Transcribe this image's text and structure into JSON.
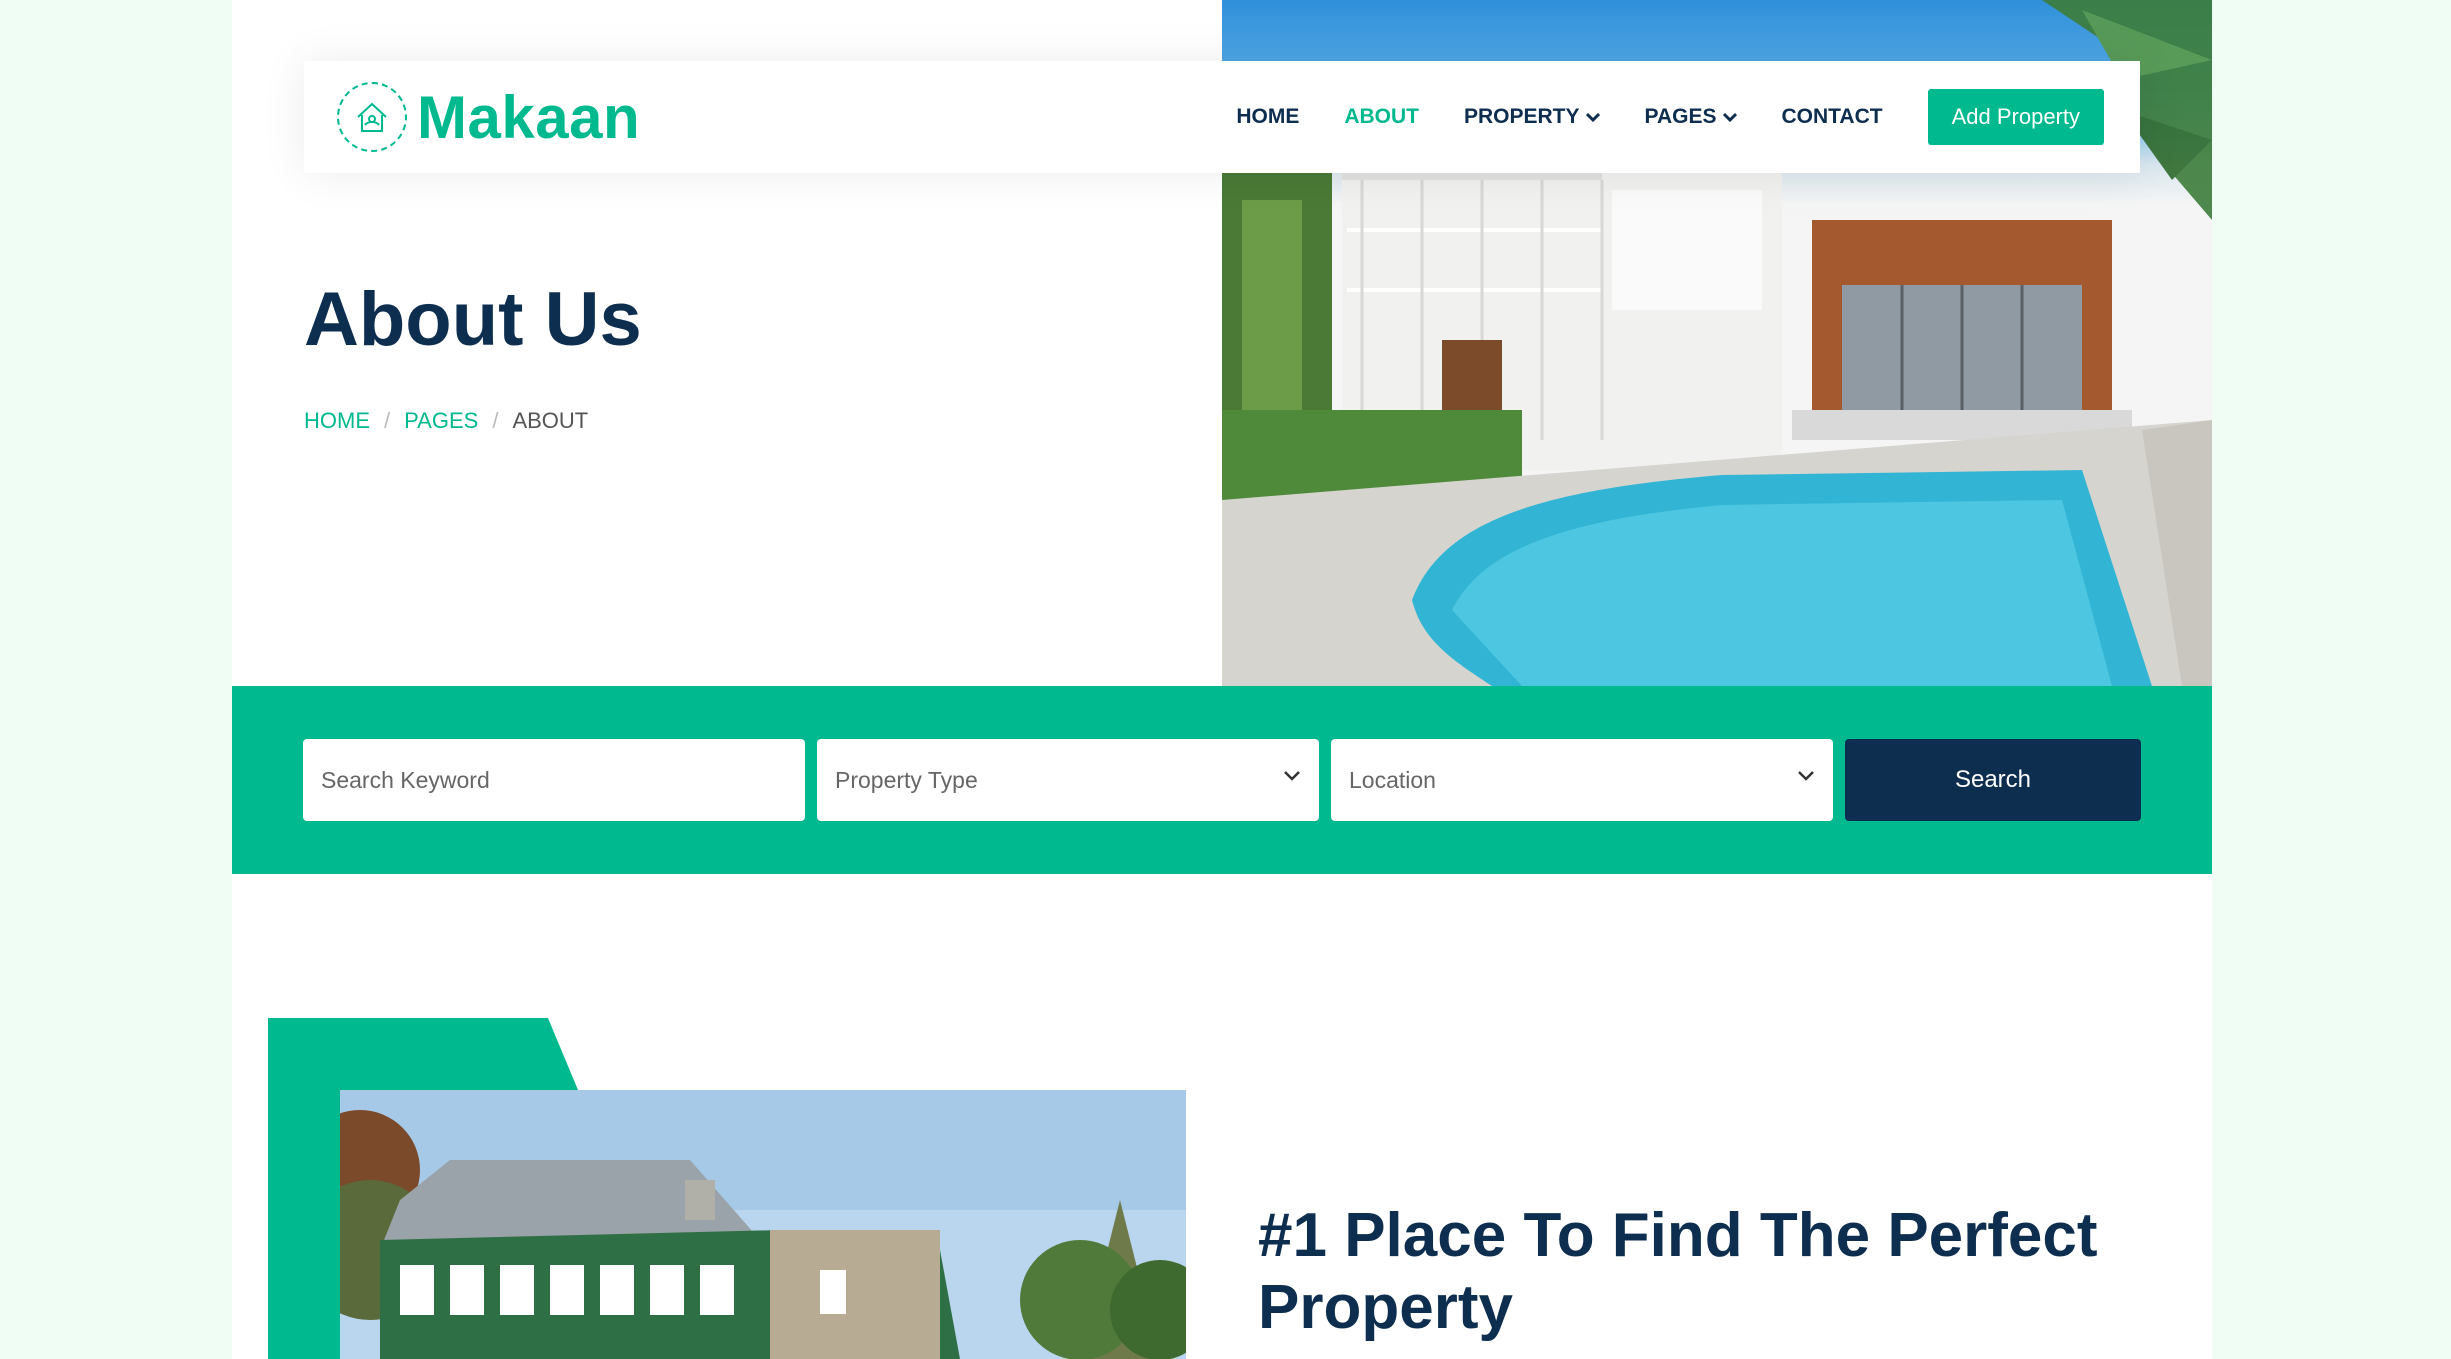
{
  "brand": {
    "name": "Makaan",
    "icon": "house-handshake-icon"
  },
  "nav": {
    "items": [
      {
        "label": "HOME",
        "active": false,
        "dropdown": false
      },
      {
        "label": "ABOUT",
        "active": true,
        "dropdown": false
      },
      {
        "label": "PROPERTY",
        "active": false,
        "dropdown": true
      },
      {
        "label": "PAGES",
        "active": false,
        "dropdown": true
      },
      {
        "label": "CONTACT",
        "active": false,
        "dropdown": false
      }
    ],
    "cta_label": "Add Property"
  },
  "hero": {
    "title": "About Us",
    "breadcrumb": [
      "HOME",
      "PAGES",
      "ABOUT"
    ],
    "image": "house-with-pool-photo"
  },
  "search": {
    "keyword_placeholder": "Search Keyword",
    "property_type_placeholder": "Property Type",
    "location_placeholder": "Location",
    "button_label": "Search"
  },
  "about": {
    "heading": "#1 Place To Find The Perfect Property",
    "image": "green-house-photo"
  },
  "colors": {
    "primary": "#00b98e",
    "dark": "#0e2e50",
    "page_bg": "#effdf5"
  }
}
